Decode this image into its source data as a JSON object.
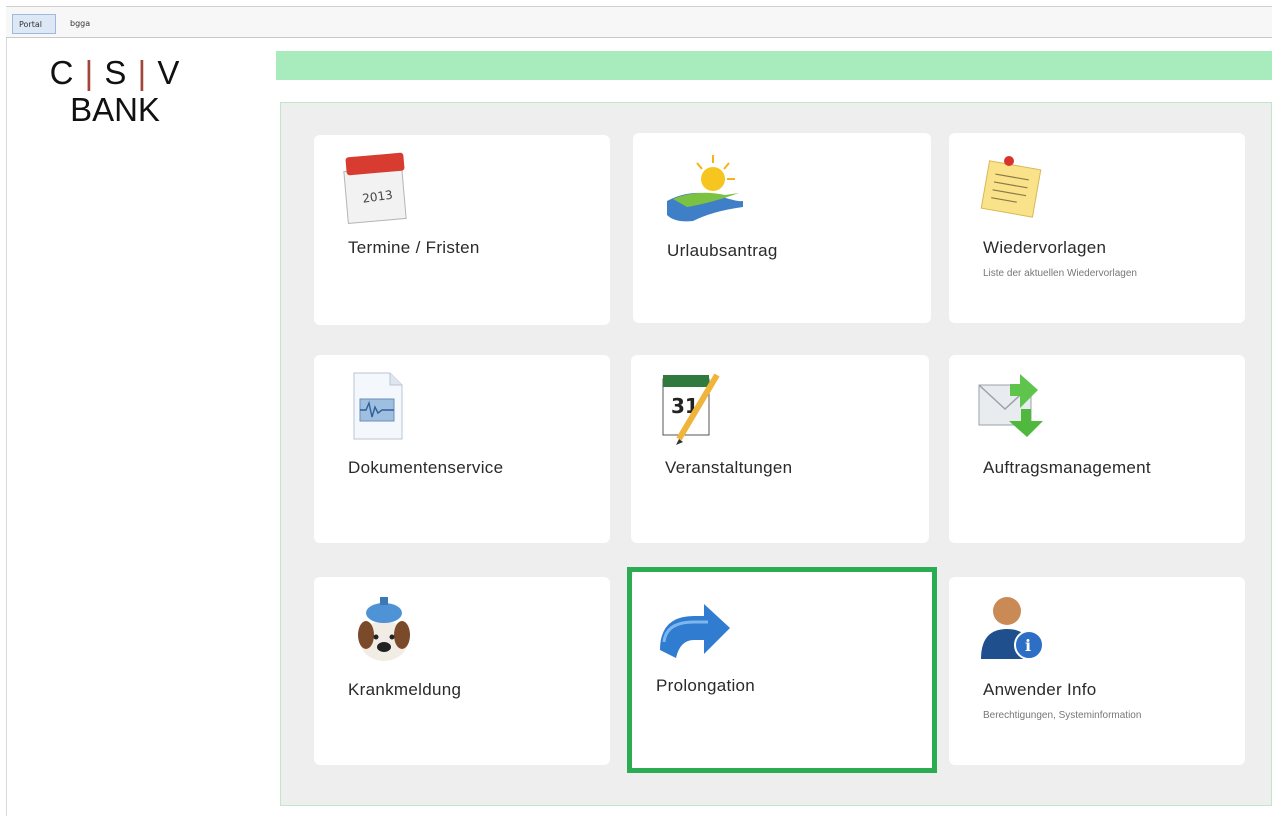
{
  "tabs": [
    {
      "label": "Portal",
      "active": true
    },
    {
      "label": "bgga",
      "active": false
    }
  ],
  "logo": {
    "c": "C",
    "s": "S",
    "v": "V",
    "sep": "|",
    "bank": "BANK"
  },
  "colors": {
    "green_bar": "#a8ecbe",
    "selection": "#2bab52",
    "logo_separator": "#a0463a"
  },
  "tiles": [
    {
      "title": "Termine / Fristen",
      "subtitle": "",
      "icon": "calendar-2013-icon"
    },
    {
      "title": "Urlaubsantrag",
      "subtitle": "",
      "icon": "sun-landscape-icon"
    },
    {
      "title": "Wiedervorlagen",
      "subtitle": "Liste der aktuellen Wiedervorlagen",
      "icon": "sticky-note-icon"
    },
    {
      "title": "Dokumentenservice",
      "subtitle": "",
      "icon": "document-icon"
    },
    {
      "title": "Veranstaltungen",
      "subtitle": "",
      "icon": "calendar-31-icon"
    },
    {
      "title": "Auftragsmanagement",
      "subtitle": "",
      "icon": "mail-arrows-icon"
    },
    {
      "title": "Krankmeldung",
      "subtitle": "",
      "icon": "sick-dog-icon"
    },
    {
      "title": "Prolongation",
      "subtitle": "",
      "icon": "curved-arrow-icon",
      "selected": true
    },
    {
      "title": "Anwender Info",
      "subtitle": "Berechtigungen, Systeminformation",
      "icon": "user-info-icon"
    }
  ]
}
